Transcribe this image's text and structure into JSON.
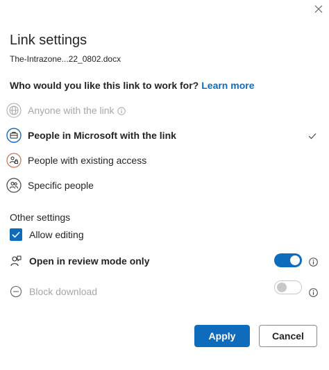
{
  "dialog": {
    "title": "Link settings",
    "filename": "The-Intrazone...22_0802.docx",
    "close_icon": "close-icon"
  },
  "question": {
    "text": "Who would you like this link to work for?",
    "learn_more": "Learn more"
  },
  "options": [
    {
      "label": "Anyone with the link",
      "icon": "globe-icon",
      "disabled": true,
      "selected": false
    },
    {
      "label": "People in Microsoft with the link",
      "icon": "briefcase-icon",
      "disabled": false,
      "selected": true
    },
    {
      "label": "People with existing access",
      "icon": "people-lock-icon",
      "disabled": false,
      "selected": false
    },
    {
      "label": "Specific people",
      "icon": "people-icon",
      "disabled": false,
      "selected": false
    }
  ],
  "other_settings": {
    "heading": "Other settings",
    "allow_editing": {
      "label": "Allow editing",
      "checked": true
    },
    "review_mode": {
      "label": "Open in review mode only",
      "on": true
    },
    "block_download": {
      "label": "Block download",
      "on": false,
      "disabled": true
    }
  },
  "buttons": {
    "apply": "Apply",
    "cancel": "Cancel"
  },
  "colors": {
    "accent": "#0f6cbd",
    "text": "#242424",
    "disabled": "#a6a6a6"
  }
}
